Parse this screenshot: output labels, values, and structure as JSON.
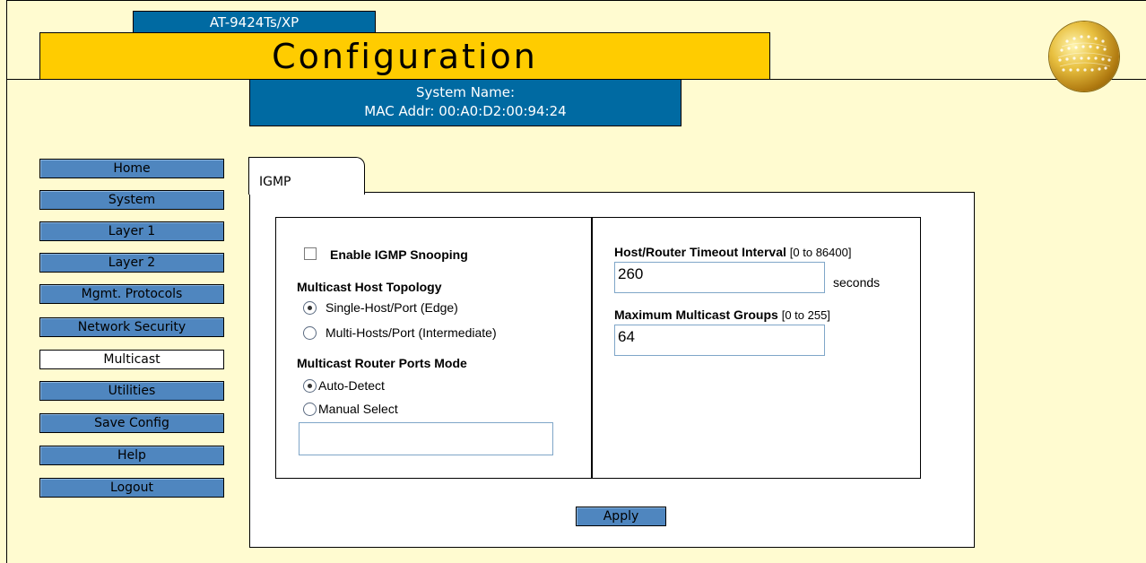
{
  "header": {
    "model": "AT-9424Ts/XP",
    "title": "Configuration",
    "system_name_label": "System Name:",
    "mac_line": "MAC Addr: 00:A0:D2:00:94:24"
  },
  "nav": {
    "items": [
      "Home",
      "System",
      "Layer 1",
      "Layer 2",
      "Mgmt. Protocols",
      "Network Security",
      "Multicast",
      "Utilities",
      "Save Config",
      "Help",
      "Logout"
    ],
    "active": "Multicast"
  },
  "tab": {
    "label": "IGMP"
  },
  "igmp": {
    "enable_label": "Enable IGMP Snooping",
    "enable_checked": false,
    "topology_heading": "Multicast Host Topology",
    "topology_options": [
      "Single-Host/Port (Edge)",
      "Multi-Hosts/Port (Intermediate)"
    ],
    "topology_selected": "Single-Host/Port (Edge)",
    "router_heading": "Multicast Router Ports Mode",
    "router_options": [
      "Auto-Detect",
      "Manual Select"
    ],
    "router_selected": "Auto-Detect",
    "manual_ports_value": "",
    "timeout_label": "Host/Router Timeout Interval",
    "timeout_range": "[0 to 86400]",
    "timeout_value": "260",
    "timeout_unit": "seconds",
    "maxgroups_label": "Maximum Multicast Groups",
    "maxgroups_range": "[0 to 255]",
    "maxgroups_value": "64",
    "apply_label": "Apply"
  },
  "colors": {
    "background": "#fffbd0",
    "title_bar": "#ffcc00",
    "info_bar": "#006aa2",
    "nav_button": "#4f86bf",
    "nav_active": "#ffffff"
  },
  "icons": {
    "logo": "gold-globe-logo-icon"
  }
}
